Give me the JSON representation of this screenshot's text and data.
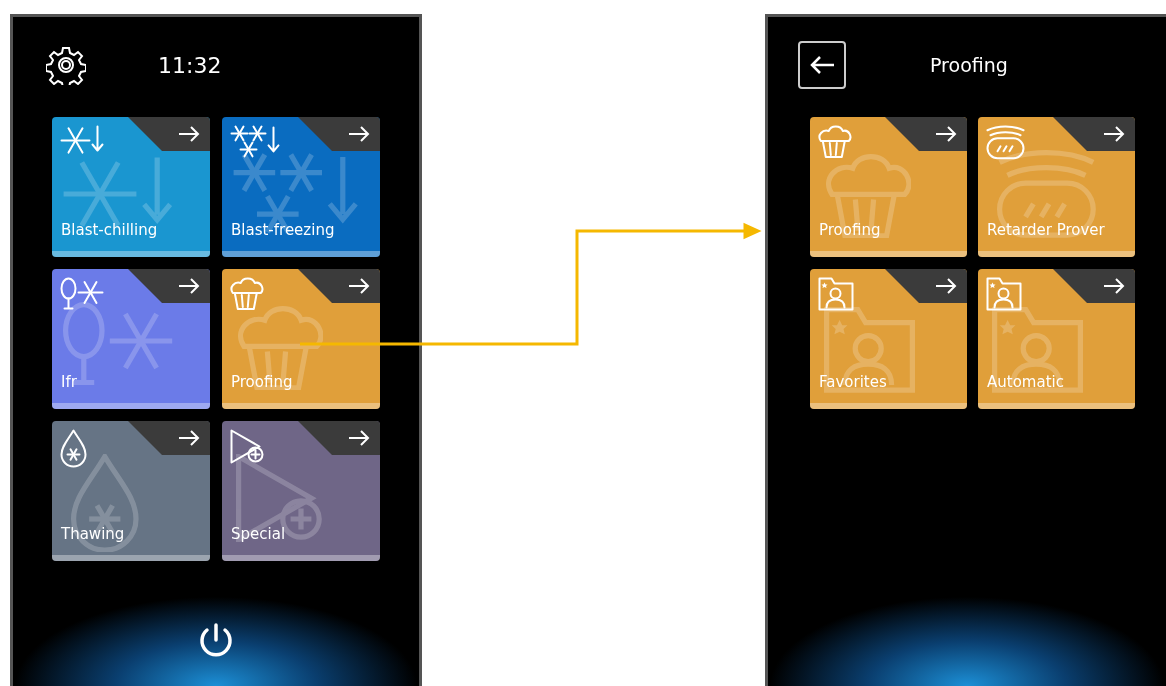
{
  "main_screen": {
    "time": "11:32",
    "tiles": [
      {
        "label": "Blast-chilling",
        "kind": "chill",
        "color": "#1a96d0"
      },
      {
        "label": "Blast-freezing",
        "kind": "freeze",
        "color": "#0a6cc0"
      },
      {
        "label": "Ifr",
        "kind": "ifr",
        "color": "#6b7be8"
      },
      {
        "label": "Proofing",
        "kind": "proof",
        "color": "#e09f3a"
      },
      {
        "label": "Thawing",
        "kind": "thaw",
        "color": "#667485"
      },
      {
        "label": "Special",
        "kind": "special",
        "color": "#6f6687"
      }
    ]
  },
  "detail_screen": {
    "title": "Proofing",
    "tiles": [
      {
        "label": "Proofing",
        "kind": "proof",
        "color": "#e09f3a"
      },
      {
        "label": "Retarder Prover",
        "kind": "retarder",
        "color": "#e09f3a"
      },
      {
        "label": "Favorites",
        "kind": "program",
        "color": "#e09f3a"
      },
      {
        "label": "Automatic",
        "kind": "program",
        "color": "#e09f3a"
      }
    ]
  }
}
